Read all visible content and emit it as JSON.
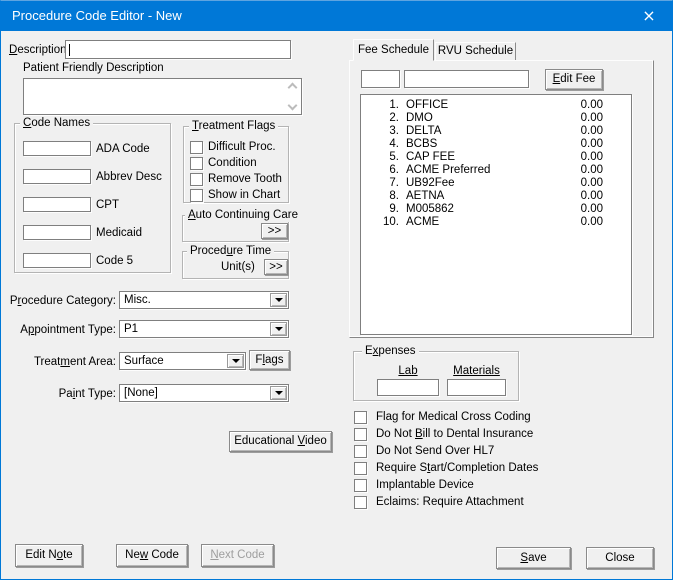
{
  "window": {
    "title": "Procedure Code Editor - New",
    "close_glyph": "×"
  },
  "colors": {
    "titlebar": "#0078d7",
    "window_border": "#0078d7",
    "body": "#f0f0f0",
    "disabled_text": "#9e9e9e"
  },
  "form": {
    "description": {
      "label": "[D]escription:",
      "value": ""
    },
    "patient_friendly": {
      "label": "Patient Friendly Description",
      "value": ""
    },
    "code_names": {
      "legend": "[C]ode Names",
      "fields": [
        {
          "label": "ADA Code",
          "value": ""
        },
        {
          "label": "Abbrev Desc",
          "value": ""
        },
        {
          "label": "CPT",
          "value": ""
        },
        {
          "label": "Medicaid",
          "value": ""
        },
        {
          "label": "Code 5",
          "value": ""
        }
      ]
    },
    "treatment_flags": {
      "legend": "[T]reatment Flags",
      "items": [
        {
          "label": "Difficult Proc.",
          "checked": false
        },
        {
          "label": "Condition",
          "checked": false
        },
        {
          "label": "Remove Tooth",
          "checked": false
        },
        {
          "label": "Show in Chart",
          "checked": false
        }
      ]
    },
    "auto_continuing_care": {
      "legend": "[A]uto Continuing Care",
      "expand_button": ">>"
    },
    "procedure_time": {
      "legend": "Proced[u]re Time",
      "unit_label": "Unit(s)",
      "expand_button": ">>"
    },
    "procedure_category": {
      "label": "P[r]ocedure Category:",
      "value": "Misc."
    },
    "appointment_type": {
      "label": "A[p]pointment Type:",
      "value": "P1"
    },
    "treatment_area": {
      "label": "Treat[m]ent Area:",
      "value": "Surface",
      "flags_button": "F[l]ags"
    },
    "paint_type": {
      "label": "Pa[i]nt Type:",
      "value": "[None]"
    },
    "educational_video_button": "Educational [V]ideo"
  },
  "fee_panel": {
    "tabs": [
      {
        "label": "Fee Schedule",
        "active": true
      },
      {
        "label": "RVU Schedule",
        "active": false
      }
    ],
    "input_left": "",
    "input_right": "",
    "edit_fee_button": "[E]dit Fee",
    "fees": [
      {
        "n": "1.",
        "name": "OFFICE",
        "amount": "0.00"
      },
      {
        "n": "2.",
        "name": "DMO",
        "amount": "0.00"
      },
      {
        "n": "3.",
        "name": "DELTA",
        "amount": "0.00"
      },
      {
        "n": "4.",
        "name": "BCBS",
        "amount": "0.00"
      },
      {
        "n": "5.",
        "name": "CAP FEE",
        "amount": "0.00"
      },
      {
        "n": "6.",
        "name": "ACME Preferred",
        "amount": "0.00"
      },
      {
        "n": "7.",
        "name": "UB92Fee",
        "amount": "0.00"
      },
      {
        "n": "8.",
        "name": "AETNA",
        "amount": "0.00"
      },
      {
        "n": "9.",
        "name": "M005862",
        "amount": "0.00"
      },
      {
        "n": "10.",
        "name": "ACME",
        "amount": "0.00"
      }
    ]
  },
  "expenses": {
    "legend": "E[x]penses",
    "lab_label": "Lab",
    "materials_label": "Materials",
    "lab_value": "",
    "materials_value": ""
  },
  "medical_flags": [
    {
      "label": "Fla[g] for Medical Cross Coding",
      "checked": false
    },
    {
      "label": "Do Not [B]ill to Dental Insurance",
      "checked": false
    },
    {
      "label": "Do Not Send Over HL7",
      "checked": false
    },
    {
      "label": "Require S[t]art/Completion Dates",
      "checked": false
    },
    {
      "label": "Implantable Device",
      "checked": false
    },
    {
      "label": "Eclaims: Require Attachment",
      "checked": false
    }
  ],
  "footer": {
    "edit_note": "Edit N[o]te",
    "new_code": "Ne[w] Code",
    "next_code": "[N]ext Code",
    "next_code_enabled": false,
    "save": "[S]ave",
    "close": "Close"
  }
}
